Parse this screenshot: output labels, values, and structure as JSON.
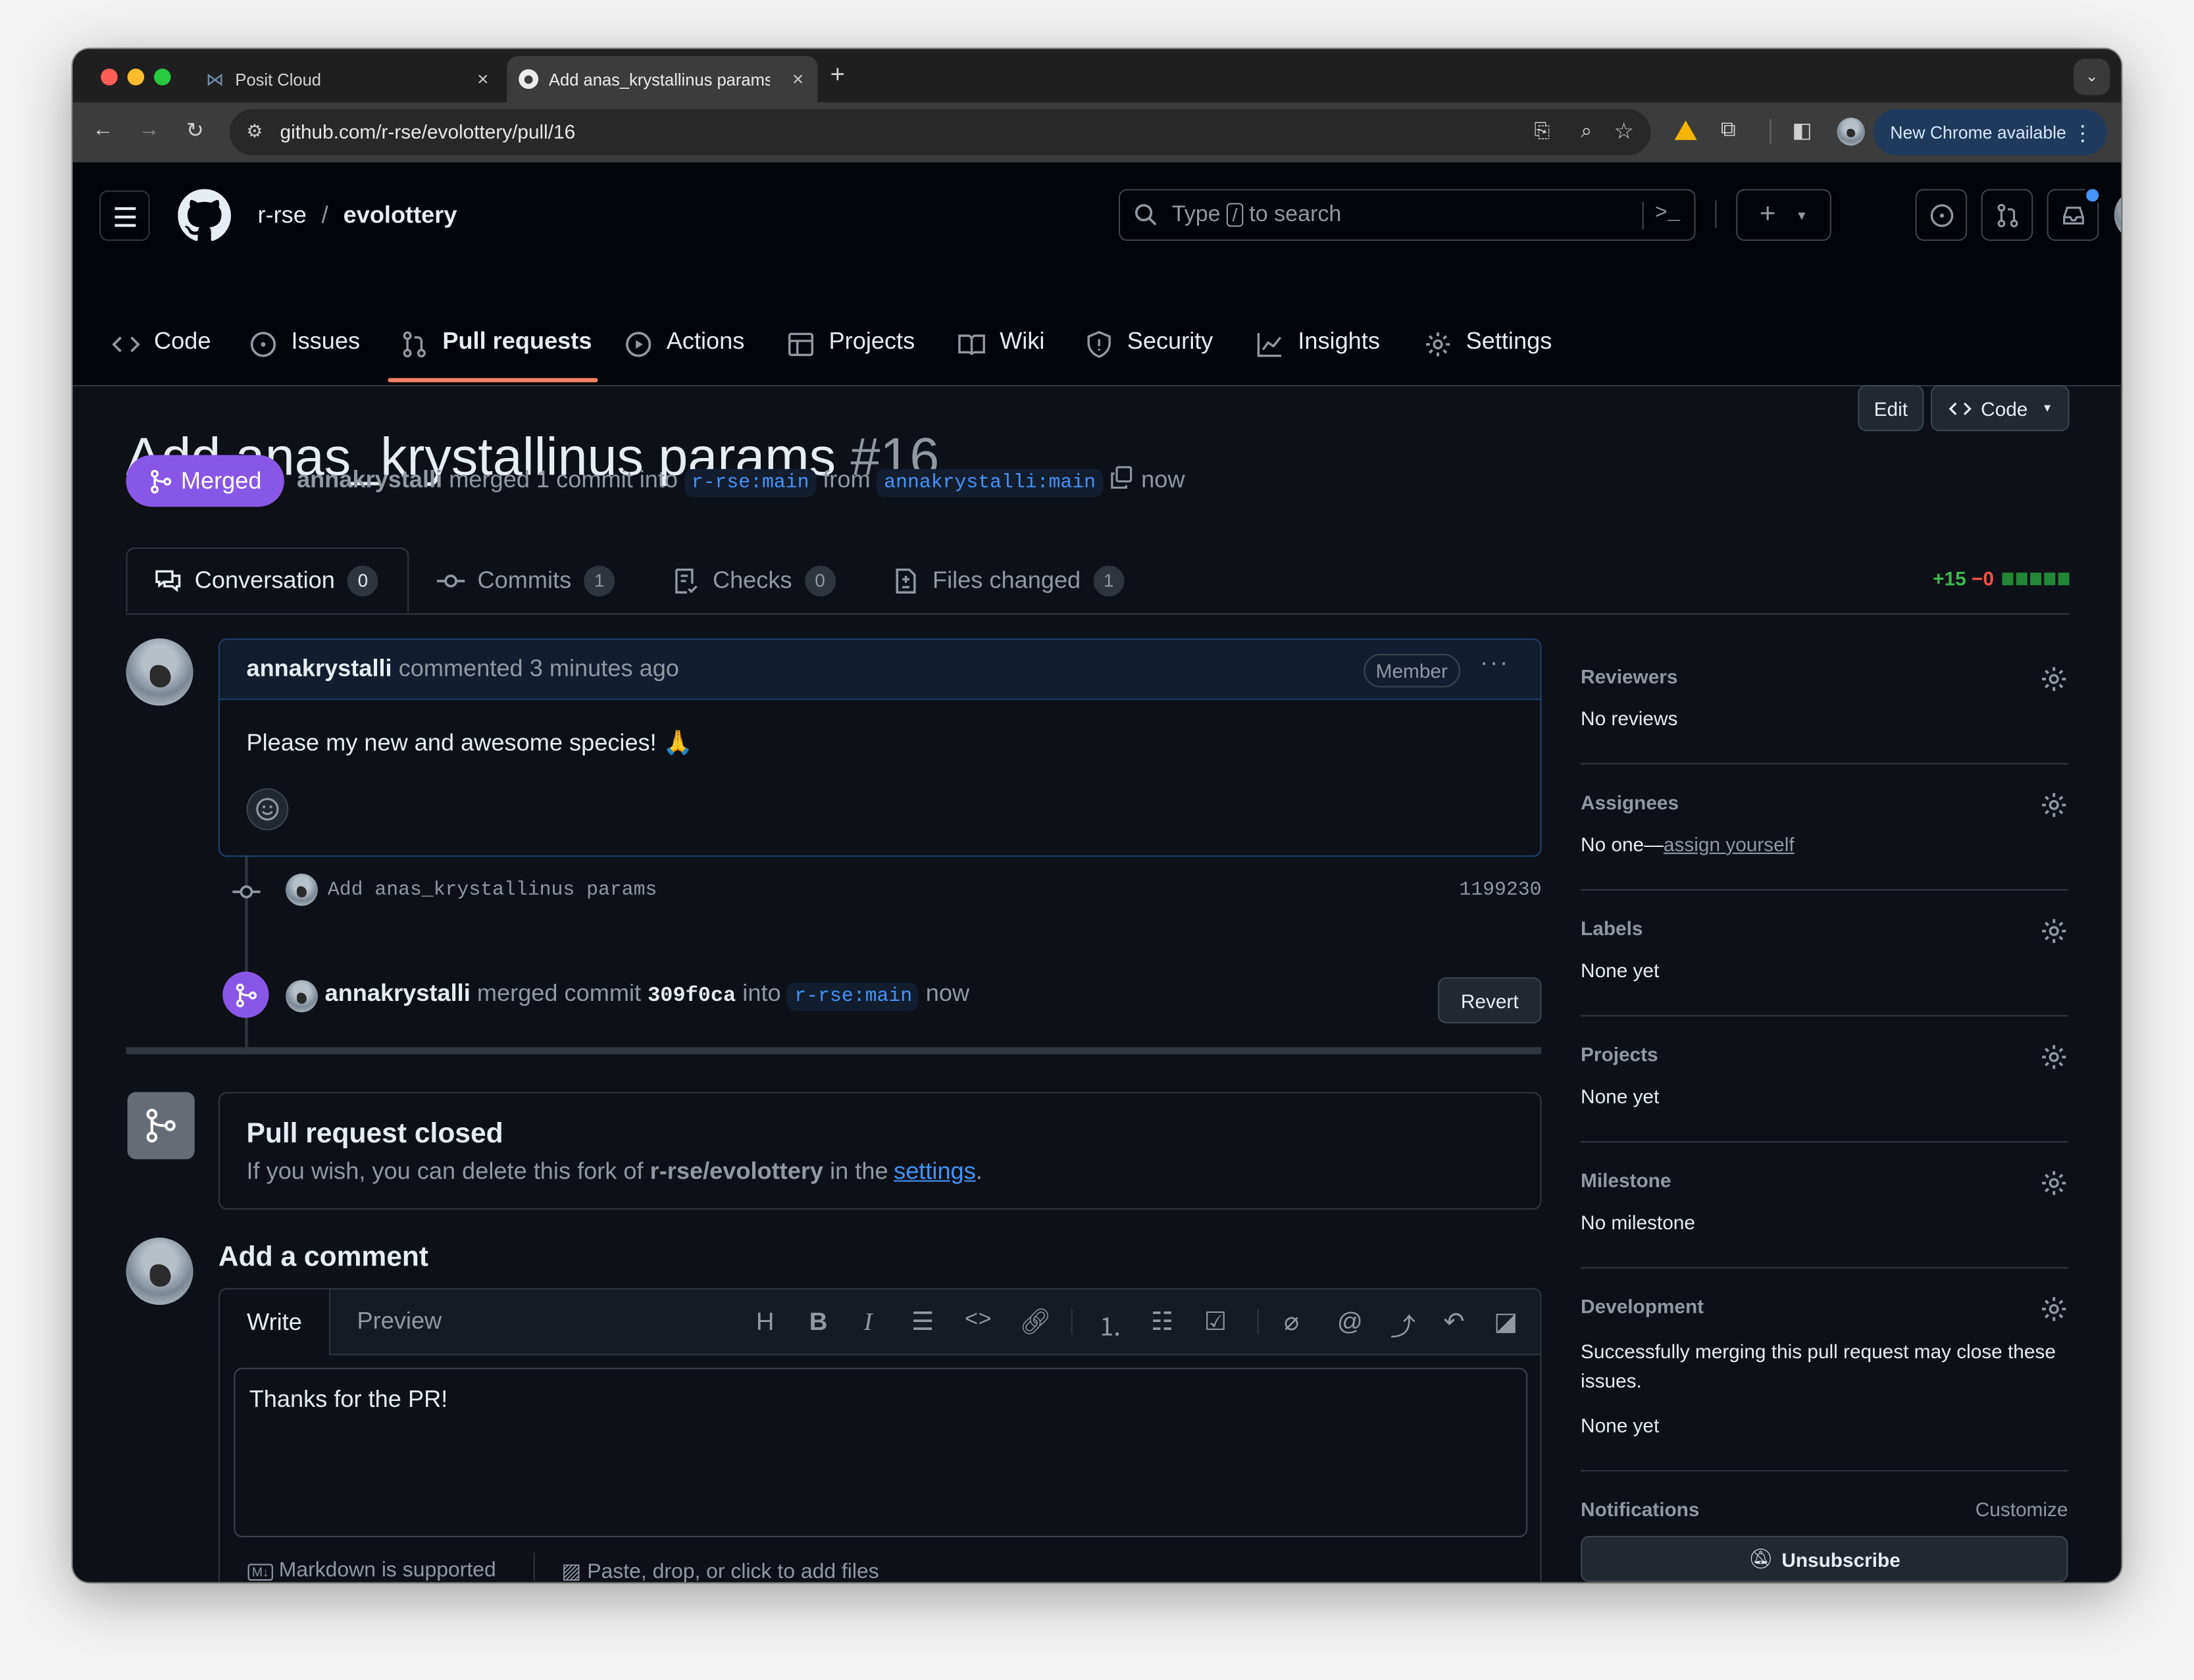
{
  "browser": {
    "tabs": [
      {
        "title": "Posit Cloud",
        "active": false
      },
      {
        "title": "Add anas_krystallinus params",
        "active": true
      }
    ],
    "url": "github.com/r-rse/evolottery/pull/16",
    "new_chrome_label": "New Chrome available"
  },
  "header": {
    "owner": "r-rse",
    "separator": "/",
    "repo": "evolottery",
    "search_prefix": "Type",
    "search_key": "/",
    "search_suffix": "to search"
  },
  "repo_nav": [
    {
      "label": "Code",
      "icon": "code-icon"
    },
    {
      "label": "Issues",
      "icon": "issue-icon"
    },
    {
      "label": "Pull requests",
      "icon": "pull-request-icon",
      "active": true
    },
    {
      "label": "Actions",
      "icon": "play-icon"
    },
    {
      "label": "Projects",
      "icon": "table-icon"
    },
    {
      "label": "Wiki",
      "icon": "book-icon"
    },
    {
      "label": "Security",
      "icon": "shield-icon"
    },
    {
      "label": "Insights",
      "icon": "graph-icon"
    },
    {
      "label": "Settings",
      "icon": "gear-icon"
    }
  ],
  "pr": {
    "title": "Add anas_krystallinus params",
    "number": "#16",
    "edit_label": "Edit",
    "code_label": "Code",
    "state_label": "Merged",
    "author": "annakrystalli",
    "merged_text": "merged 1 commit into",
    "base_branch": "r-rse:main",
    "from_text": "from",
    "head_branch": "annakrystalli:main",
    "time": "now"
  },
  "pr_tabs": [
    {
      "label": "Conversation",
      "count": "0",
      "icon": "comment-icon",
      "active": true
    },
    {
      "label": "Commits",
      "count": "1",
      "icon": "commit-icon"
    },
    {
      "label": "Checks",
      "count": "0",
      "icon": "checklist-icon"
    },
    {
      "label": "Files changed",
      "count": "1",
      "icon": "file-diff-icon"
    }
  ],
  "diffstat": {
    "additions": "+15",
    "deletions": "−0",
    "green_blocks": 5
  },
  "comment": {
    "author": "annakrystalli",
    "action": "commented 3 minutes ago",
    "role": "Member",
    "body": "Please my new and awesome species! 🙏"
  },
  "commit": {
    "message": "Add anas_krystallinus params",
    "sha": "1199230"
  },
  "merge_event": {
    "author": "annakrystalli",
    "text": "merged commit",
    "sha": "309f0ca",
    "into": "into",
    "branch": "r-rse:main",
    "time": "now",
    "revert_label": "Revert"
  },
  "closed": {
    "title": "Pull request closed",
    "text_before": "If you wish, you can delete this fork of",
    "repo": "r-rse/evolottery",
    "text_mid": "in the",
    "link": "settings",
    "text_end": "."
  },
  "add_comment": {
    "heading": "Add a comment",
    "write_tab": "Write",
    "preview_tab": "Preview",
    "value": "Thanks for the PR!",
    "markdown_note": "Markdown is supported",
    "files_note": "Paste, drop, or click to add files"
  },
  "sidebar": {
    "reviewers": {
      "label": "Reviewers",
      "value": "No reviews"
    },
    "assignees": {
      "label": "Assignees",
      "value_prefix": "No one—",
      "link": "assign yourself"
    },
    "labels": {
      "label": "Labels",
      "value": "None yet"
    },
    "projects": {
      "label": "Projects",
      "value": "None yet"
    },
    "milestone": {
      "label": "Milestone",
      "value": "No milestone"
    },
    "development": {
      "label": "Development",
      "text": "Successfully merging this pull request may close these issues.",
      "value": "None yet"
    },
    "notifications": {
      "label": "Notifications",
      "customize": "Customize",
      "unsubscribe": "Unsubscribe"
    }
  },
  "colors": {
    "merged": "#8957e5",
    "link": "#4493f8",
    "addition": "#3fb950",
    "deletion": "#f85149",
    "active_tab_underline": "#f78166"
  }
}
